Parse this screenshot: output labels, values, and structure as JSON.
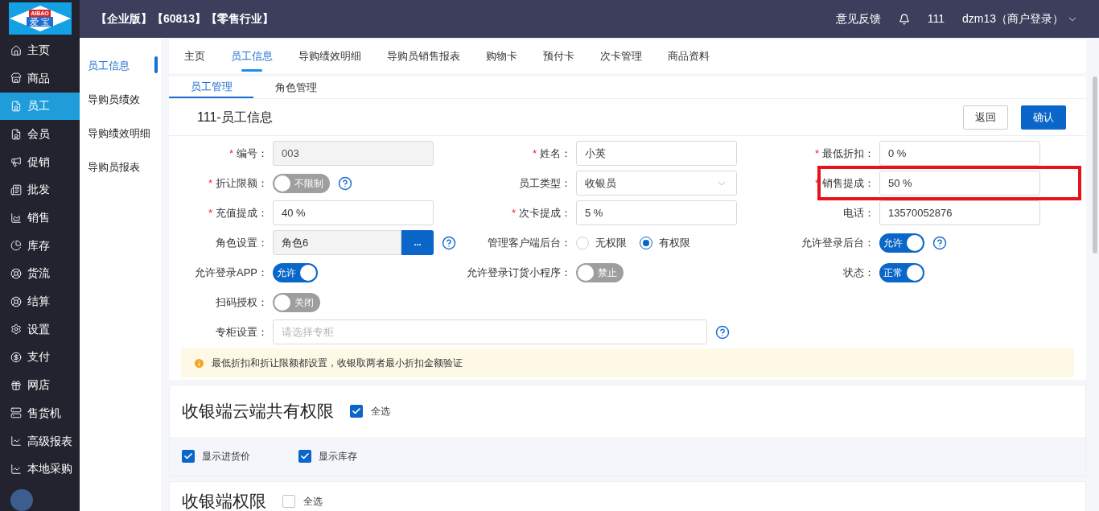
{
  "logo": {
    "brand": "AIBAO",
    "name": "爱 宝"
  },
  "header": {
    "title": "【企业版】【60813】【零售行业】",
    "feedback": "意见反馈",
    "count": "111",
    "user": "dzm13（商户登录）"
  },
  "sidebar": {
    "items": [
      {
        "label": "主页",
        "selected": false
      },
      {
        "label": "商品",
        "selected": false
      },
      {
        "label": "员工",
        "selected": true
      },
      {
        "label": "会员",
        "selected": false
      },
      {
        "label": "促销",
        "selected": false
      },
      {
        "label": "批发",
        "selected": false
      },
      {
        "label": "销售",
        "selected": false
      },
      {
        "label": "库存",
        "selected": false
      },
      {
        "label": "货流",
        "selected": false
      },
      {
        "label": "结算",
        "selected": false
      },
      {
        "label": "设置",
        "selected": false
      },
      {
        "label": "支付",
        "selected": false
      },
      {
        "label": "网店",
        "selected": false
      },
      {
        "label": "售货机",
        "selected": false
      },
      {
        "label": "高级报表",
        "selected": false
      },
      {
        "label": "本地采购",
        "selected": false
      }
    ]
  },
  "subnav": {
    "items": [
      {
        "label": "员工信息",
        "selected": true
      },
      {
        "label": "导购员绩效",
        "selected": false
      },
      {
        "label": "导购绩效明细",
        "selected": false
      },
      {
        "label": "导购员报表",
        "selected": false
      }
    ]
  },
  "tabs": [
    {
      "label": "主页",
      "selected": false
    },
    {
      "label": "员工信息",
      "selected": true
    },
    {
      "label": "导购绩效明细",
      "selected": false
    },
    {
      "label": "导购员销售报表",
      "selected": false
    },
    {
      "label": "购物卡",
      "selected": false
    },
    {
      "label": "预付卡",
      "selected": false
    },
    {
      "label": "次卡管理",
      "selected": false
    },
    {
      "label": "商品资料",
      "selected": false
    }
  ],
  "subtabs": [
    {
      "label": "员工管理",
      "selected": true
    },
    {
      "label": "角色管理",
      "selected": false
    }
  ],
  "card": {
    "title": "111-员工信息",
    "buttons": [
      {
        "label": "返回",
        "kind": "secondary"
      },
      {
        "label": "确认",
        "kind": "primary"
      }
    ]
  },
  "form": {
    "rows": [
      {
        "fields": [
          {
            "kind": "input",
            "label": "编号：",
            "required": "*",
            "value": "003",
            "disabled": true
          },
          {
            "kind": "input",
            "label": "姓名：",
            "required": "*",
            "value": "小英"
          },
          {
            "kind": "input",
            "label": "最低折扣：",
            "required": "*",
            "value": "0 %"
          }
        ]
      },
      {
        "fields": [
          {
            "kind": "toggle",
            "label": "折让限额：",
            "required": "*",
            "on": false,
            "text": "不限制",
            "help": true
          },
          {
            "kind": "select",
            "label": "员工类型：",
            "value": "收银员"
          },
          {
            "kind": "input",
            "label": "销售提成：",
            "required": "*",
            "value": "50 %",
            "highlighted": true
          }
        ]
      },
      {
        "fields": [
          {
            "kind": "input",
            "label": "充值提成：",
            "required": "*",
            "value": "40 %"
          },
          {
            "kind": "input",
            "label": "次卡提成：",
            "required": "*",
            "value": "5 %"
          },
          {
            "kind": "input",
            "label": "电话：",
            "value": "13570052876"
          }
        ]
      },
      {
        "fields": [
          {
            "kind": "picker",
            "label": "角色设置：",
            "value": "角色6",
            "button": "...",
            "help": true
          },
          {
            "kind": "radio",
            "label": "管理客户端后台：",
            "options": [
              {
                "label": "无权限",
                "selected": false
              },
              {
                "label": "有权限",
                "selected": true
              }
            ]
          },
          {
            "kind": "toggle",
            "label": "允许登录后台：",
            "on": true,
            "text": "允许",
            "help": true
          }
        ]
      },
      {
        "fields": [
          {
            "kind": "toggle",
            "label": "允许登录APP：",
            "on": true,
            "text": "允许"
          },
          {
            "kind": "toggle",
            "label": "允许登录订货小程序：",
            "on": false,
            "text": "禁止"
          },
          {
            "kind": "toggle",
            "label": "状态：",
            "on": true,
            "text": "正常"
          }
        ]
      },
      {
        "fields": [
          {
            "kind": "toggle",
            "label": "扫码授权：",
            "on": false,
            "text": "关闭"
          }
        ]
      },
      {
        "fields": [
          {
            "kind": "input",
            "label": "专柜设置：",
            "placeholder": "请选择专柜",
            "wide": true,
            "help": true
          }
        ]
      }
    ],
    "notice": "最低折扣和折让限额都设置，收银取两者最小折扣金额验证"
  },
  "sections": [
    {
      "title": "收银端云端共有权限",
      "select_all": {
        "label": "全选",
        "checked": true
      },
      "options": [
        {
          "label": "显示进货价",
          "checked": true
        },
        {
          "label": "显示库存",
          "checked": true
        }
      ]
    },
    {
      "title": "收银端权限",
      "select_all": {
        "label": "全选",
        "checked": false
      }
    }
  ]
}
